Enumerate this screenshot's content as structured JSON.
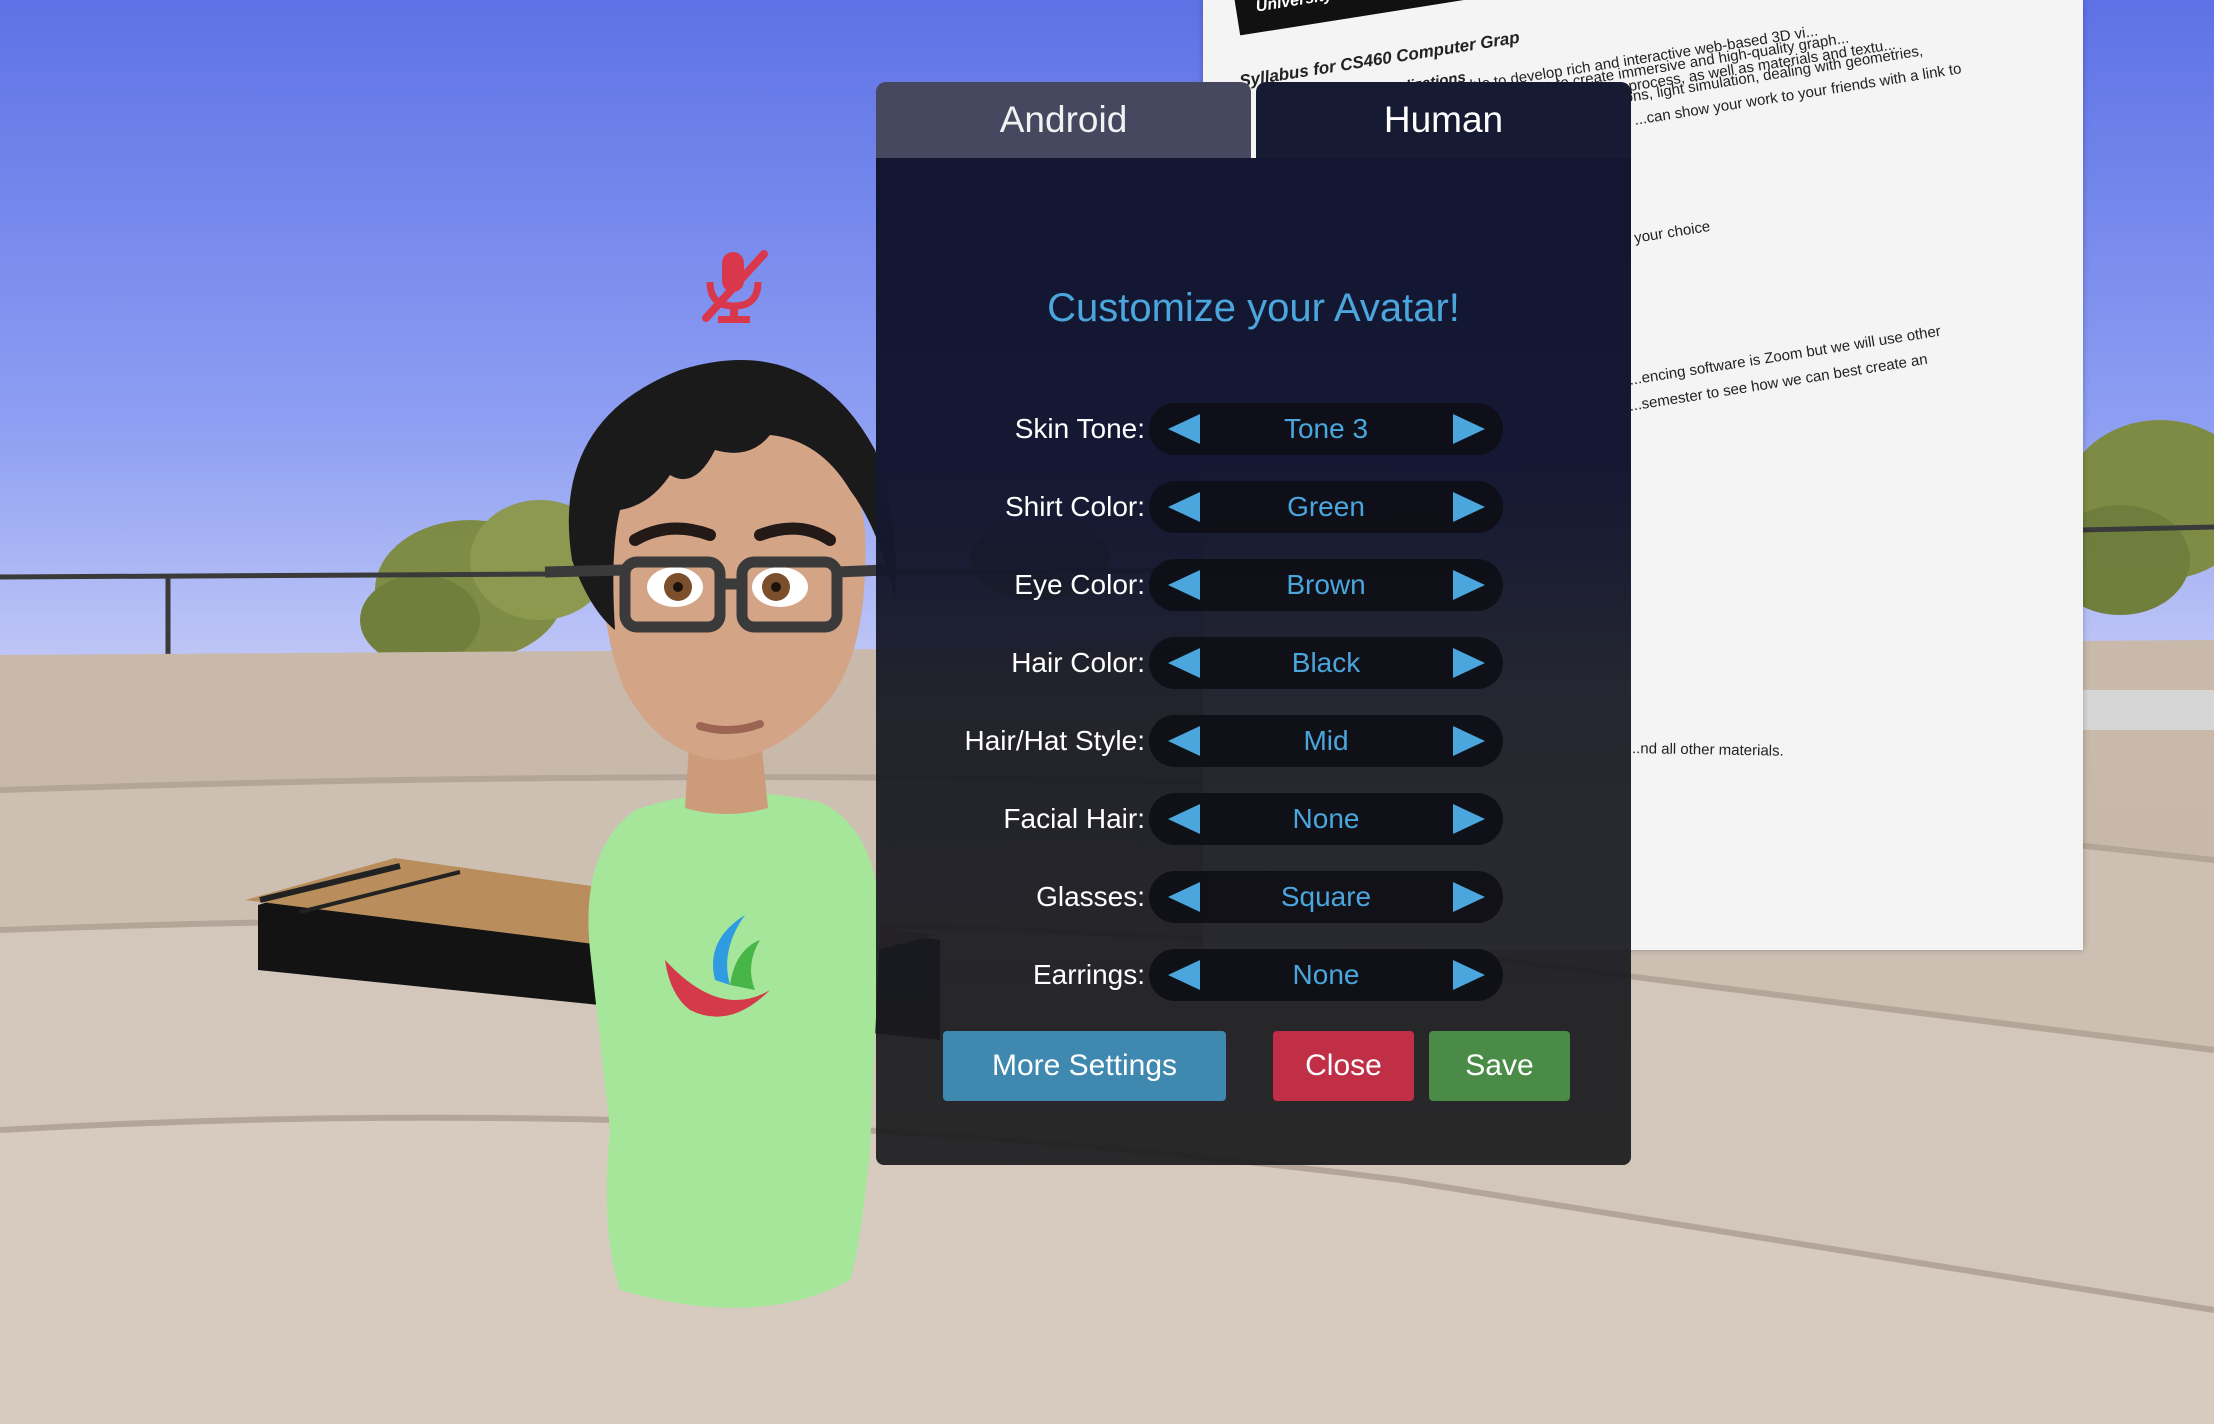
{
  "board": {
    "university": "University",
    "title": "Syllabus for CS460 Computer Grap",
    "subtitle": "3D Visualizations",
    "lines": [
      "...will be able to develop rich and interactive web-based 3D vi...",
      "...you will learn to create immersive and high-quality graph...",
      "...image-rendering process, as well as materials and textu...",
      "...ntations, light simulation, dealing with geometries,",
      "...can show your work to your friends with a link to",
      "your choice",
      "...encing software is Zoom but we will use other",
      "...semester to see how we can best create an",
      "...nd all other materials."
    ]
  },
  "tabs": [
    {
      "label": "Android",
      "selected": false
    },
    {
      "label": "Human",
      "selected": true
    }
  ],
  "title": "Customize your Avatar!",
  "options": [
    {
      "label": "Skin Tone:",
      "value": "Tone 3"
    },
    {
      "label": "Shirt Color:",
      "value": "Green"
    },
    {
      "label": "Eye Color:",
      "value": "Brown"
    },
    {
      "label": "Hair Color:",
      "value": "Black"
    },
    {
      "label": "Hair/Hat Style:",
      "value": "Mid"
    },
    {
      "label": "Facial Hair:",
      "value": "None"
    },
    {
      "label": "Glasses:",
      "value": "Square"
    },
    {
      "label": "Earrings:",
      "value": "None"
    }
  ],
  "buttons": {
    "more_settings": "More Settings",
    "close": "Close",
    "save": "Save"
  },
  "colors": {
    "accent": "#4aa6dc",
    "more_settings": "#3f89b0",
    "close": "#c02f46",
    "save": "#4a8b47",
    "mute_icon": "#d9374b",
    "shirt": "#a6e69a"
  },
  "icons": {
    "mute": "microphone-muted-icon",
    "prev": "arrow-left-icon",
    "next": "arrow-right-icon"
  }
}
